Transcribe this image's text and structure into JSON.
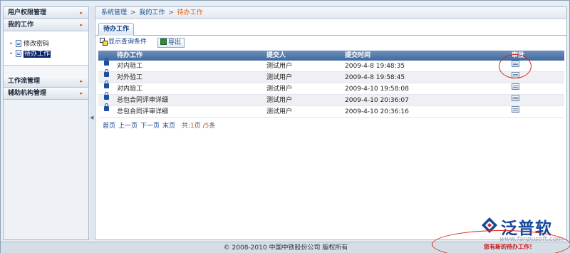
{
  "sidebar": {
    "sections": [
      {
        "label": "用户权限管理"
      },
      {
        "label": "我的工作"
      },
      {
        "label": "工作流管理"
      },
      {
        "label": "辅助机构管理"
      }
    ],
    "tree": [
      {
        "label": "修改密码",
        "selected": false
      },
      {
        "label": "待办工作",
        "selected": true
      }
    ],
    "arrow": "▸"
  },
  "breadcrumb": {
    "items": [
      "系统管理",
      "我的工作",
      "待办工作"
    ],
    "separator": ">"
  },
  "tab": {
    "label": "待办工作"
  },
  "toolbar": {
    "show_query": "显示查询条件",
    "export": "导出"
  },
  "grid": {
    "columns": [
      "待办工作",
      "提交人",
      "提交时间",
      "审批"
    ],
    "rows": [
      {
        "task": "对内验工",
        "user": "测试用户",
        "time": "2009-4-8 19:48:35"
      },
      {
        "task": "对外验工",
        "user": "测试用户",
        "time": "2009-4-8 19:58:45"
      },
      {
        "task": "对内验工",
        "user": "测试用户",
        "time": "2009-4-10 19:58:08"
      },
      {
        "task": "总包合同评审详细",
        "user": "测试用户",
        "time": "2009-4-10 20:36:07"
      },
      {
        "task": "总包合同评审详细",
        "user": "测试用户",
        "time": "2009-4-10 20:36:16"
      }
    ]
  },
  "pager": {
    "first": "首页",
    "prev": "上一页",
    "next": "下一页",
    "last": "末页",
    "prefix": "共:",
    "current": "1",
    "page_word": "页 /",
    "total": "5",
    "suffix": "条"
  },
  "footer": {
    "copyright": "© 2008-2010 中国中铁股份公司  版权所有"
  },
  "notice": "您有新的待办工作！",
  "brand": {
    "name": "泛普软件",
    "url": "www.fanpusoft.com"
  },
  "colors": {
    "accent": "#3f6aa1",
    "highlight": "#e0241b",
    "brand": "#14489a"
  }
}
